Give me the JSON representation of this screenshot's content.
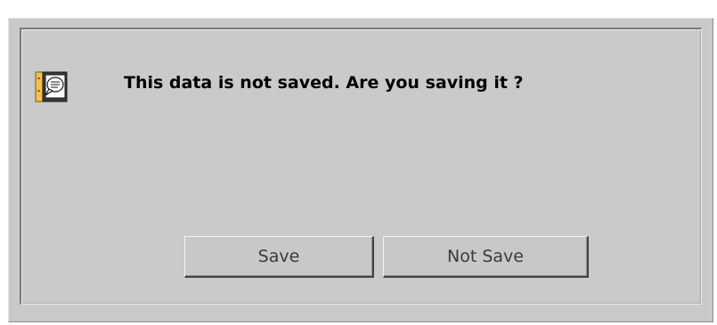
{
  "dialog": {
    "message": "This data is not saved. Are you saving it ?",
    "icon": "message-document-icon",
    "buttons": {
      "save_label": "Save",
      "not_save_label": "Not Save"
    }
  },
  "colors": {
    "dialog_bg": "#c9c9c9",
    "icon_book": "#f2c14e",
    "icon_dark": "#3b3b3b"
  }
}
